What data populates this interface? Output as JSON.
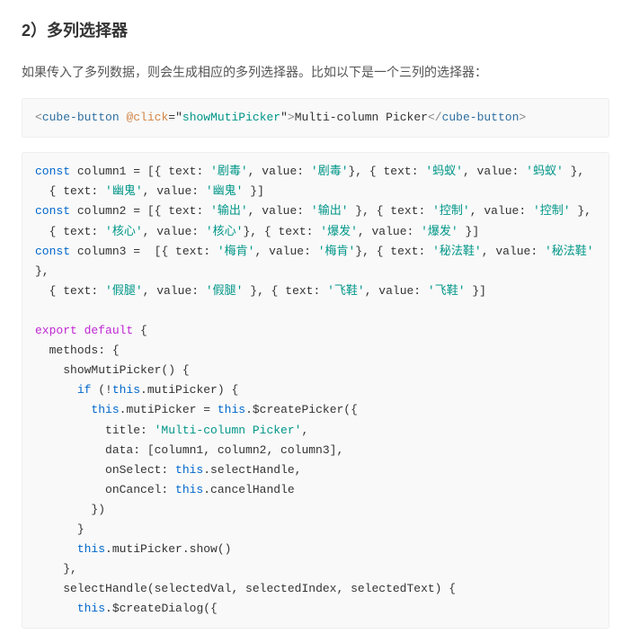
{
  "heading": "2）多列选择器",
  "intro": "如果传入了多列数据，则会生成相应的多列选择器。比如以下是一个三列的选择器：",
  "snippet1": {
    "open_angle": "<",
    "tag": "cube-button",
    "space": " ",
    "attr": "@click",
    "eq": "=",
    "q1": "\"",
    "val": "showMutiPicker",
    "q2": "\"",
    "gt": ">",
    "text": "Multi-column Picker",
    "close_angle": "</",
    "tag2": "cube-button",
    "close_gt": ">"
  },
  "c": {
    "const": "const",
    "col1": "column1 = [{ text: ",
    "s1a": "'剧毒'",
    "p1": ", value: ",
    "s1b": "'剧毒'",
    "p2": "}, { text: ",
    "s1c": "'蚂蚁'",
    "s1d": "'蚂蚁'",
    "p3": " },",
    "c1l2a": "  { text: ",
    "s1e": "'幽鬼'",
    "s1f": "'幽鬼'",
    "c1l2b": "}]",
    "col2": "column2 = [{ text: ",
    "s2a": "'输出'",
    "s2b": "'输出'",
    "p4": " }, { text: ",
    "s2c": "'控制'",
    "s2d": "'控制'",
    "p5": " },",
    "c2l2a": "  { text: ",
    "s2e": "'核心'",
    "s2f": "'核心'",
    "p6": "}, { text: ",
    "s2g": "'爆发'",
    "s2h": "'爆发'",
    "c2l2b": " }]",
    "col3": "column3 =  [{ text: ",
    "s3a": "'梅肯'",
    "s3b": "'梅肯'",
    "s3c": "'秘法鞋'",
    "s3d": "'秘法鞋'",
    "c3l2a": "  { text: ",
    "s3e": "'假腿'",
    "s3f": "'假腿'",
    "s3g": "'飞鞋'",
    "s3h": "'飞鞋'",
    "c3l2b": " }]",
    "export": "export default",
    "obrace": " {",
    "methods": "  methods: {",
    "show": "    showMutiPicker() {",
    "if": "if",
    "ifline_a": "      ",
    "ifline_b": " (!",
    "this": "this",
    "ifline_c": ".mutiPicker) {",
    "assign_a": "        ",
    "assign_b": ".mutiPicker = ",
    "assign_c": ".$createPicker({",
    "titleline_a": "          title: ",
    "title_s": "'Multi-column Picker'",
    "titleline_b": ",",
    "dataline": "          data: [column1, column2, column3],",
    "onselect_a": "          onSelect: ",
    "onselect_b": ".selectHandle,",
    "oncancel_a": "          onCancel: ",
    "oncancel_b": ".cancelHandle",
    "closeobj": "        })",
    "closeif": "      }",
    "showcall_a": "      ",
    "showcall_b": ".mutiPicker.show()",
    "closefn": "    },",
    "selh": "    selectHandle(selectedVal, selectedIndex, selectedText) {",
    "dialog_a": "      ",
    "dialog_b": ".$createDialog({"
  }
}
